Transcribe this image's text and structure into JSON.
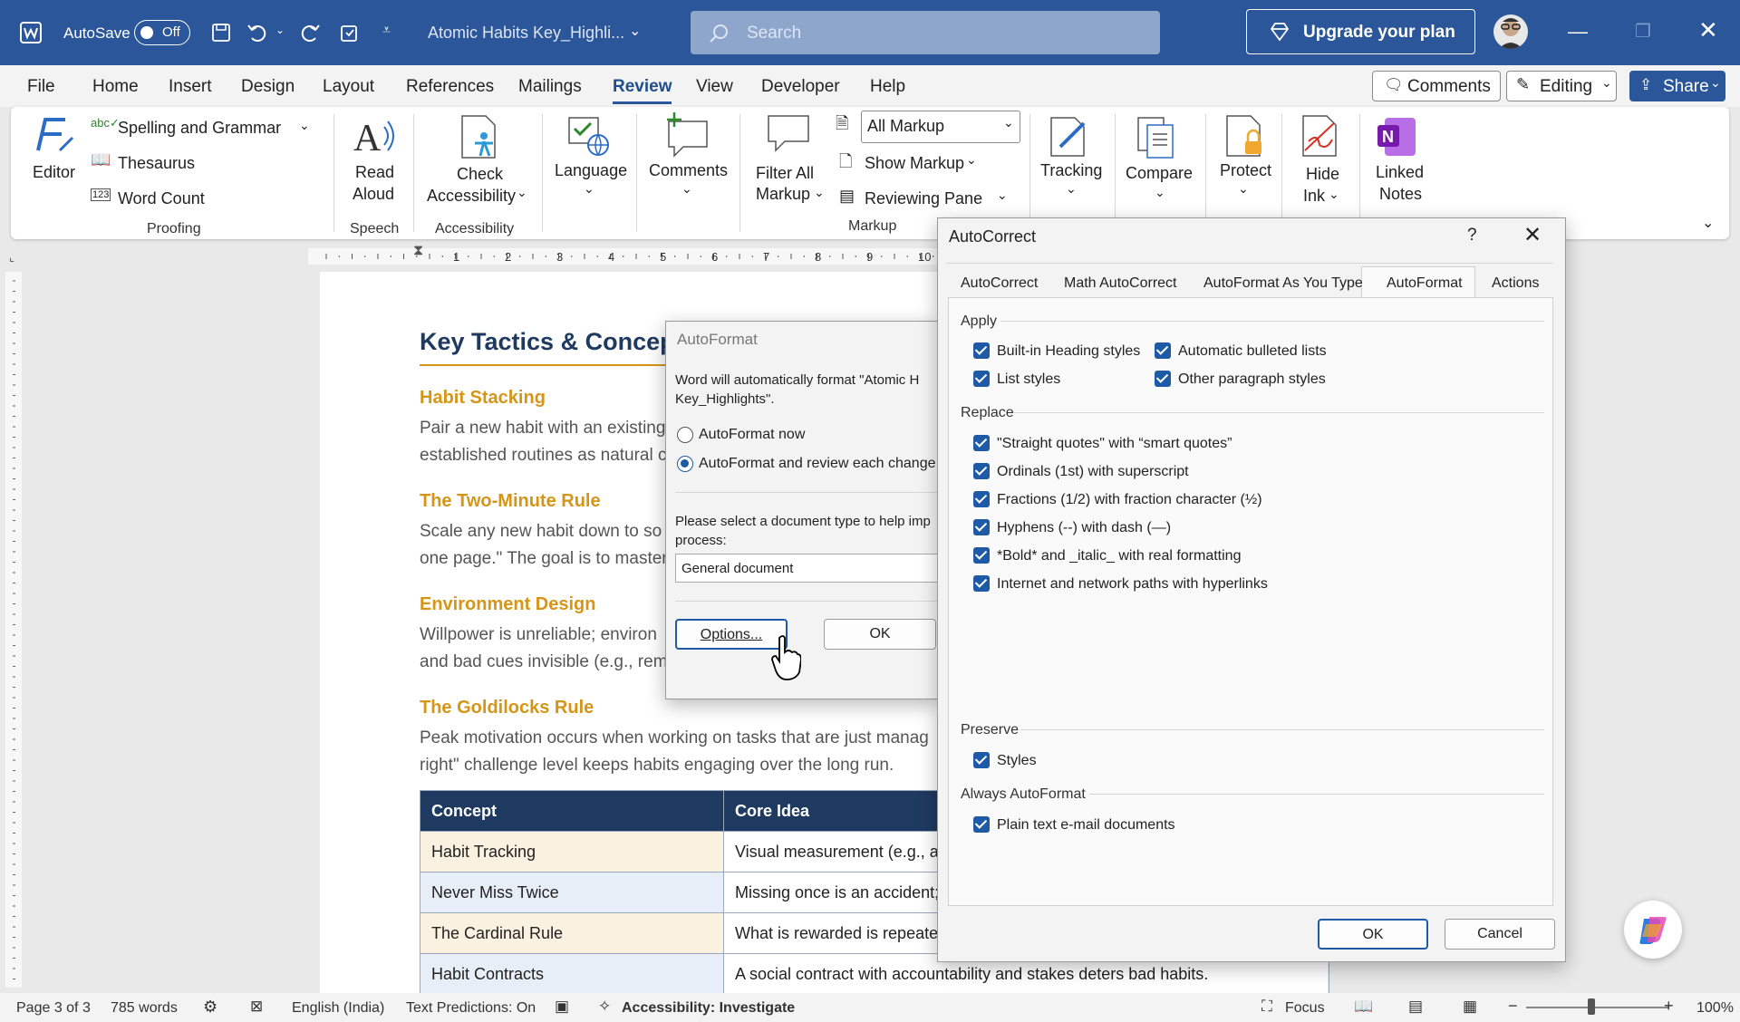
{
  "titlebar": {
    "autosave_label": "AutoSave",
    "autosave_state": "Off",
    "doc_title": "Atomic Habits Key_Highli...",
    "search_placeholder": "Search",
    "upgrade_label": "Upgrade your plan"
  },
  "menu": {
    "items": [
      "File",
      "Home",
      "Insert",
      "Design",
      "Layout",
      "References",
      "Mailings",
      "Review",
      "View",
      "Developer",
      "Help"
    ],
    "active": "Review",
    "comments_label": "Comments",
    "editing_label": "Editing",
    "share_label": "Share"
  },
  "ribbon": {
    "editor": "Editor",
    "spelling": "Spelling and Grammar",
    "thesaurus": "Thesaurus",
    "word_count": "Word Count",
    "proofing": "Proofing",
    "read_aloud_1": "Read",
    "read_aloud_2": "Aloud",
    "speech": "Speech",
    "check_acc_1": "Check",
    "check_acc_2": "Accessibility",
    "accessibility": "Accessibility",
    "language": "Language",
    "comments": "Comments",
    "filter_1": "Filter All",
    "filter_2": "Markup",
    "all_markup": "All Markup",
    "show_markup": "Show Markup",
    "reviewing_pane": "Reviewing Pane",
    "markup": "Markup",
    "tracking": "Tracking",
    "compare": "Compare",
    "protect": "Protect",
    "hide_ink_1": "Hide",
    "hide_ink_2": "Ink",
    "linked_notes_1": "Linked",
    "linked_notes_2": "Notes"
  },
  "ruler": {
    "numbers": [
      "1",
      "2",
      "3",
      "4",
      "5",
      "6",
      "7",
      "8",
      "9",
      "10"
    ]
  },
  "document": {
    "heading": "Key Tactics & Concept",
    "sections": [
      {
        "title": "Habit Stacking",
        "lines": [
          "Pair a new habit with an existing",
          "established routines as natural c"
        ]
      },
      {
        "title": "The Two-Minute Rule",
        "lines": [
          "Scale any new habit down to so",
          "one page.\" The goal is to master"
        ]
      },
      {
        "title": "Environment Design",
        "lines": [
          "Willpower is unreliable; environ",
          "and bad cues invisible (e.g., removing apps from your phone) is far"
        ]
      },
      {
        "title": "The Goldilocks Rule",
        "lines": [
          "Peak motivation occurs when working on tasks that are just manag",
          "right\" challenge level keeps habits engaging over the long run."
        ]
      }
    ],
    "table": {
      "headers": [
        "Concept",
        "Core Idea"
      ],
      "rows": [
        [
          "Habit Tracking",
          "Visual measurement (e.g., a"
        ],
        [
          "Never Miss Twice",
          "Missing once is an accident;"
        ],
        [
          "The Cardinal Rule",
          "What is rewarded is repeate"
        ],
        [
          "Habit Contracts",
          "A social contract with accountability and stakes deters bad habits."
        ]
      ]
    }
  },
  "autoformat_dialog": {
    "title": "AutoFormat",
    "message_1": "Word will automatically format \"Atomic H",
    "message_2": "Key_Highlights\".",
    "option_now": "AutoFormat now",
    "option_review": "AutoFormat and review each change",
    "select_label_1": "Please select a document type to help imp",
    "select_label_2": "process:",
    "doc_type": "General document",
    "options_button": "Options...",
    "ok_button": "OK"
  },
  "autocorrect_dialog": {
    "title": "AutoCorrect",
    "help": "?",
    "tabs": [
      "AutoCorrect",
      "Math AutoCorrect",
      "AutoFormat As You Type",
      "AutoFormat",
      "Actions"
    ],
    "active_tab": "AutoFormat",
    "apply_label": "Apply",
    "apply_items": [
      "Built-in Heading styles",
      "Automatic bulleted lists",
      "List styles",
      "Other paragraph styles"
    ],
    "replace_label": "Replace",
    "replace_items": [
      "\"Straight quotes\" with “smart quotes”",
      "Ordinals (1st) with superscript",
      "Fractions (1/2) with fraction character (½)",
      "Hyphens (--) with dash (—)",
      "*Bold* and _italic_ with real formatting",
      "Internet and network paths with hyperlinks"
    ],
    "preserve_label": "Preserve",
    "preserve_items": [
      "Styles"
    ],
    "always_label": "Always AutoFormat",
    "always_items": [
      "Plain text e-mail documents"
    ],
    "ok_button": "OK",
    "cancel_button": "Cancel"
  },
  "statusbar": {
    "page": "Page 3 of 3",
    "words": "785 words",
    "language": "English (India)",
    "text_predictions": "Text Predictions: On",
    "accessibility": "Accessibility: Investigate",
    "focus": "Focus",
    "zoom": "100%"
  },
  "colors": {
    "accent": "#2b579a",
    "checkbox": "#1f5aa6",
    "heading": "#1f3a60",
    "subheading": "#d59618"
  }
}
